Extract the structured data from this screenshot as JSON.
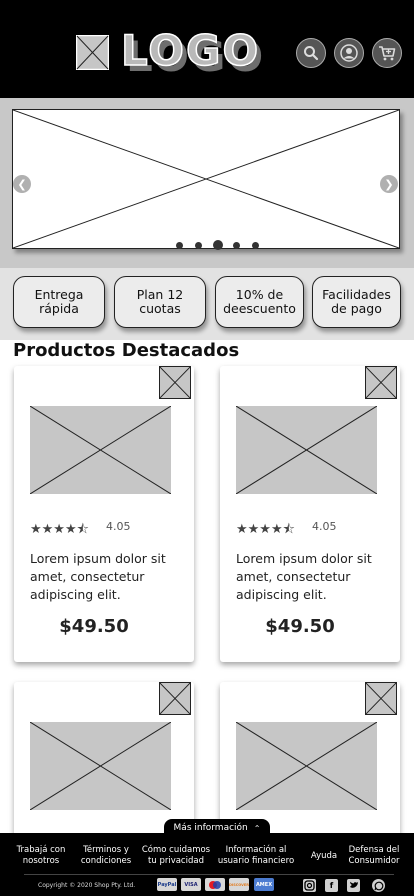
{
  "header": {
    "logo_text": "LOGO",
    "icons": [
      "search-icon",
      "user-icon",
      "cart-icon"
    ]
  },
  "carousel": {
    "slide_count": 5,
    "active_slide": 3
  },
  "features": [
    {
      "label": "Entrega rápida"
    },
    {
      "label": "Plan 12 cuotas"
    },
    {
      "label": "10% de deescuento"
    },
    {
      "label": "Facilidades de pago"
    }
  ],
  "section": {
    "title": "Productos Destacados"
  },
  "products": [
    {
      "rating": "4.05",
      "description": "Lorem ipsum dolor sit amet, consectetur adipiscing elit.",
      "price": "$49.50"
    },
    {
      "rating": "4.05",
      "description": "Lorem ipsum dolor sit amet, consectetur adipiscing elit.",
      "price": "$49.50"
    }
  ],
  "more_info": {
    "label": "Más información"
  },
  "footer": {
    "links": [
      {
        "label": "Trabajá con nosotros"
      },
      {
        "label": "Términos y condiciones"
      },
      {
        "label": "Cómo cuidamos tu privacidad"
      },
      {
        "label": "Información al usuario financiero"
      },
      {
        "label": "Ayuda"
      },
      {
        "label": "Defensa del Consumidor"
      }
    ],
    "copyright": "Copyright © 2020 Shop Pty. Ltd.",
    "payments": [
      "PayPal",
      "VISA",
      "MC",
      "DISCOVER",
      "AMEX"
    ],
    "social": [
      "instagram-icon",
      "facebook-icon",
      "twitter-icon",
      "whatsapp-icon"
    ]
  },
  "colors": {
    "header_bg": "#000000",
    "placeholder": "#c6c6c6",
    "band": "#c8c8c8"
  }
}
